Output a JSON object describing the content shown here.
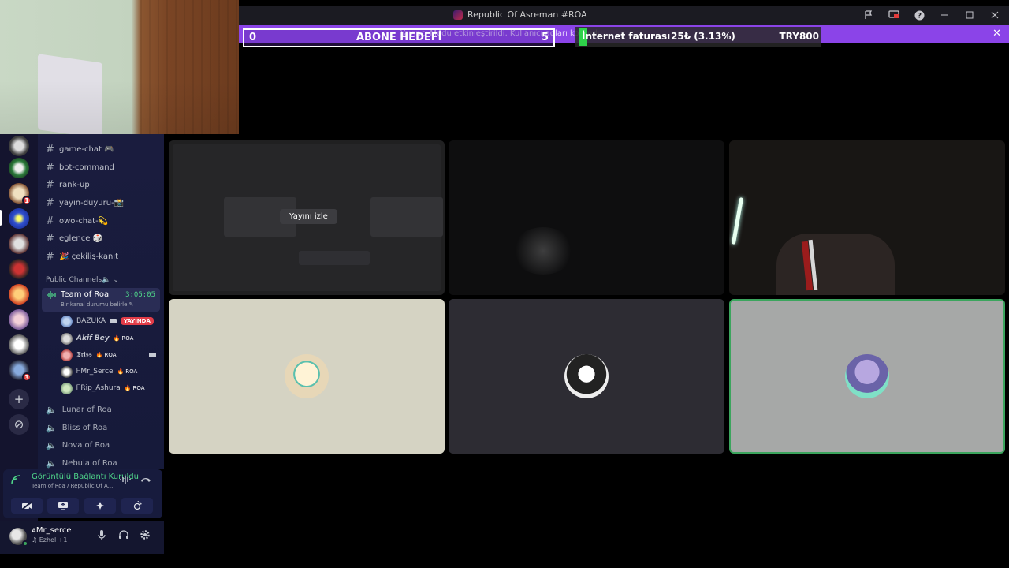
{
  "window": {
    "title": "Republic Of Asreman #ROA",
    "icons": [
      "flag-icon",
      "screen-icon",
      "help-icon",
      "minimize-icon",
      "maximize-icon",
      "close-icon"
    ]
  },
  "notice": {
    "text": "Yayıncı Modu etkinleştirildi. Kullanıcı adları korundu.",
    "close": "✕"
  },
  "overlays": {
    "goal": {
      "start": "0",
      "label": "ABONE HEDEFİ",
      "end": "5"
    },
    "bill": {
      "name": "İnternet faturası",
      "progress": "25₺ (3.13%)",
      "target": "TRY800",
      "fill_fraction": 0.0313,
      "fill_color": "#2fd24a"
    }
  },
  "server_rail": {
    "badges": [
      "1",
      "3"
    ],
    "add_label": "+",
    "discover_label": "⊘"
  },
  "text_channels": [
    {
      "name": "game-chat 🎮"
    },
    {
      "name": "bot-command"
    },
    {
      "name": "rank-up"
    },
    {
      "name": "yayın-duyuru-📸"
    },
    {
      "name": "owo-chat-💫"
    },
    {
      "name": "eglence 🎲"
    },
    {
      "name": "🎉 çekiliş-kanıt"
    }
  ],
  "category": {
    "name": "Public Channels🔈",
    "chevron": "⌄"
  },
  "active_voice": {
    "name": "Team of Roa",
    "time": "3:05:05",
    "status": "Bir kanal durumu belirle ✎",
    "members": [
      {
        "name": "BAZUKA",
        "badge": "YAYINDA",
        "camera": true,
        "color": "#6b8cc7"
      },
      {
        "name": "𝘼𝙠𝙞𝙛 𝘽𝙚𝙮",
        "tag": "ROA",
        "color": "#8a8a8a"
      },
      {
        "name": "𝕿𝖗𝖎𝖘𝖘",
        "tag": "ROA",
        "camera": true,
        "color": "#b04040"
      },
      {
        "name": "ᖴMr_Serce",
        "tag": "ROA",
        "color": "#e0e0e0"
      },
      {
        "name": "ᖴRip_Ashura",
        "tag": "ROA",
        "color": "#7fa07f"
      }
    ]
  },
  "voice_channels": [
    {
      "name": "Lunar of Roa"
    },
    {
      "name": "Bliss of Roa"
    },
    {
      "name": "Nova of Roa"
    },
    {
      "name": "Nebula of Roa"
    }
  ],
  "voice_panel": {
    "title": "Görüntülü Bağlantı Kuruldu",
    "subtitle": "Team of Roa / Republic Of A...",
    "buttons": [
      "camera-off-icon",
      "screen-share-icon",
      "activities-icon",
      "soundboard-icon"
    ]
  },
  "user": {
    "name": "ᴀMr_serce",
    "status": "♫ Ezhel +1"
  },
  "stage": {
    "watch_label": "Yayını izle"
  }
}
